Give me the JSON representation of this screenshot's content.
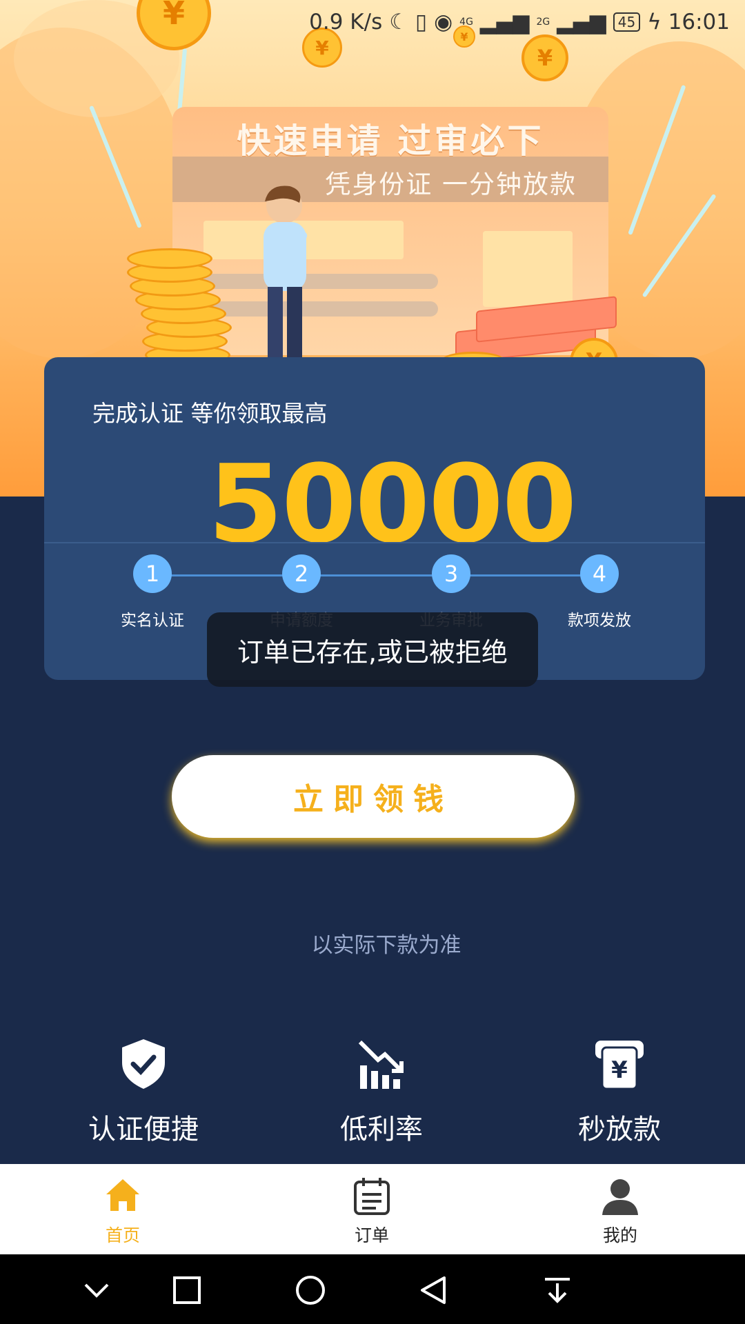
{
  "status_bar": {
    "speed": "0.9 K/s",
    "network": "4G",
    "network2": "2G",
    "battery": "45",
    "time": "16:01"
  },
  "banner": {
    "headline": "快速申请 过审必下",
    "subline": "凭身份证 一分钟放款"
  },
  "card": {
    "heading": "完成认证 等你领取最高",
    "amount": "50000",
    "steps": [
      {
        "num": "1",
        "label": "实名认证"
      },
      {
        "num": "2",
        "label": "申请额度"
      },
      {
        "num": "3",
        "label": "业务审批"
      },
      {
        "num": "4",
        "label": "款项发放"
      }
    ]
  },
  "toast": "订单已存在,或已被拒绝",
  "cta_label": "立即领钱",
  "note": "以实际下款为准",
  "features": [
    {
      "icon": "shield-check-icon",
      "label": "认证便捷"
    },
    {
      "icon": "chart-down-icon",
      "label": "低利率"
    },
    {
      "icon": "cash-machine-icon",
      "label": "秒放款"
    }
  ],
  "tabs": [
    {
      "icon": "home-icon",
      "label": "首页",
      "active": true
    },
    {
      "icon": "calendar-icon",
      "label": "订单",
      "active": false
    },
    {
      "icon": "user-icon",
      "label": "我的",
      "active": false
    }
  ],
  "colors": {
    "accent": "#f5b01c",
    "amount": "#ffc21a",
    "card": "#2c4a76",
    "background": "#1a2a4a"
  }
}
